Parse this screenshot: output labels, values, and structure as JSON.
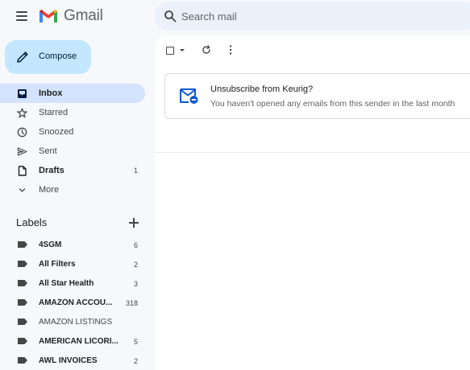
{
  "app": {
    "name": "Gmail"
  },
  "search": {
    "placeholder": "Search mail"
  },
  "compose": {
    "label": "Compose"
  },
  "nav": {
    "items": [
      {
        "label": "Inbox",
        "icon": "inbox-icon",
        "count": "",
        "active": true
      },
      {
        "label": "Starred",
        "icon": "star-icon",
        "count": ""
      },
      {
        "label": "Snoozed",
        "icon": "clock-icon",
        "count": ""
      },
      {
        "label": "Sent",
        "icon": "send-icon",
        "count": ""
      },
      {
        "label": "Drafts",
        "icon": "draft-icon",
        "count": "1"
      },
      {
        "label": "More",
        "icon": "chevron-down-icon",
        "count": ""
      }
    ]
  },
  "labels": {
    "title": "Labels",
    "items": [
      {
        "name": "4SGM",
        "count": "6"
      },
      {
        "name": "All Filters",
        "count": "2"
      },
      {
        "name": "All Star Health",
        "count": "3"
      },
      {
        "name": "AMAZON ACCOU...",
        "count": "318"
      },
      {
        "name": "AMAZON LISTINGS",
        "count": ""
      },
      {
        "name": "AMERICAN LICORI...",
        "count": "5"
      },
      {
        "name": "AWL INVOICES",
        "count": "2"
      }
    ]
  },
  "banner": {
    "title": "Unsubscribe from Keurig?",
    "subtitle": "You haven't opened any emails from this sender in the last month",
    "icon": "unsubscribe-mail-icon"
  },
  "colors": {
    "background": "#f6f8fc",
    "compose": "#c2e7ff",
    "active_nav": "#d3e3fd",
    "search": "#eaf1fb",
    "accent_blue": "#0b57d0"
  }
}
